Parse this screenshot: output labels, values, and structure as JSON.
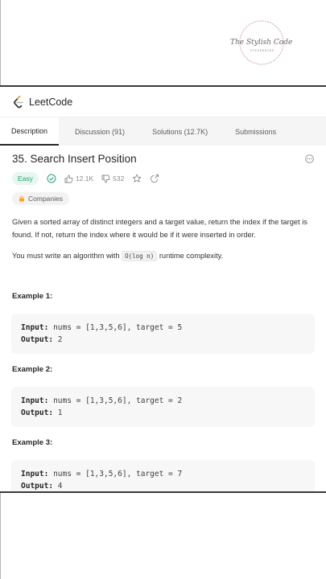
{
  "watermark": {
    "line1": "The Stylish Coder",
    "line2": "STEVEHACKS"
  },
  "app": {
    "logo_text": "LeetCode"
  },
  "tabs": [
    {
      "label": "Description"
    },
    {
      "label": "Discussion (91)"
    },
    {
      "label": "Solutions (12.7K)"
    },
    {
      "label": "Submissions"
    }
  ],
  "problem": {
    "title": "35. Search Insert Position",
    "difficulty": "Easy",
    "likes": "12.1K",
    "dislikes": "532",
    "companies_label": "Companies",
    "description": "Given a sorted array of distinct integers and a target value, return the index if the target is found. If not, return the index where it would be if it were inserted in order.",
    "complexity_prefix": "You must write an algorithm with",
    "complexity_code": "O(log n)",
    "complexity_suffix": "runtime complexity."
  },
  "examples": [
    {
      "title": "Example 1:",
      "input_label": "Input:",
      "input": "nums = [1,3,5,6], target = 5",
      "output_label": "Output:",
      "output": "2"
    },
    {
      "title": "Example 2:",
      "input_label": "Input:",
      "input": "nums = [1,3,5,6], target = 2",
      "output_label": "Output:",
      "output": "1"
    },
    {
      "title": "Example 3:",
      "input_label": "Input:",
      "input": "nums = [1,3,5,6], target = 7",
      "output_label": "Output:",
      "output": "4"
    }
  ],
  "colors": {
    "easy": "#1ea672",
    "easy_bg": "#e7f6ef",
    "accent_logo": "#ffa116"
  }
}
